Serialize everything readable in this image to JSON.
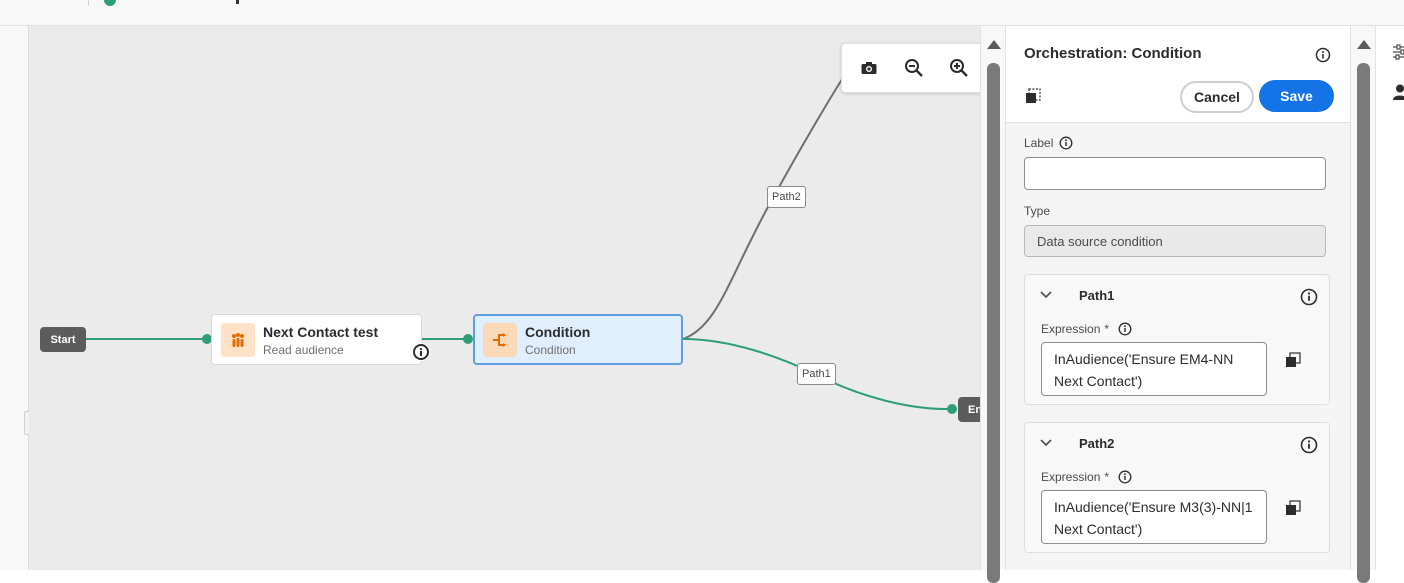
{
  "canvas": {
    "start_label": "Start",
    "end_label": "En",
    "nodes": [
      {
        "title": "Next Contact test",
        "subtitle": "Read audience",
        "icon": "audience-icon"
      },
      {
        "title": "Condition",
        "subtitle": "Condition",
        "icon": "condition-icon"
      }
    ],
    "path_labels": {
      "path1": "Path1",
      "path2": "Path2"
    },
    "zoom_tools": [
      "camera-icon",
      "zoom-out-icon",
      "zoom-in-icon"
    ],
    "colors": {
      "edge_active": "#2d9d78",
      "edge_inactive": "#6e6e6e",
      "selected_bg": "#e0efff",
      "selected_border": "#5d9fe0"
    }
  },
  "panel": {
    "title": "Orchestration: Condition",
    "cancel_label": "Cancel",
    "save_label": "Save",
    "label_field": {
      "label": "Label",
      "value": ""
    },
    "type_field": {
      "label": "Type",
      "value": "Data source condition"
    },
    "paths": [
      {
        "title": "Path1",
        "expression_label": "Expression",
        "required_mark": "*",
        "expression": "InAudience('Ensure EM4-NN Next Contact')"
      },
      {
        "title": "Path2",
        "expression_label": "Expression",
        "required_mark": "*",
        "expression": "InAudience('Ensure M3(3)-NN|1 Next Contact')"
      }
    ],
    "colors": {
      "primary": "#1473e6"
    }
  }
}
